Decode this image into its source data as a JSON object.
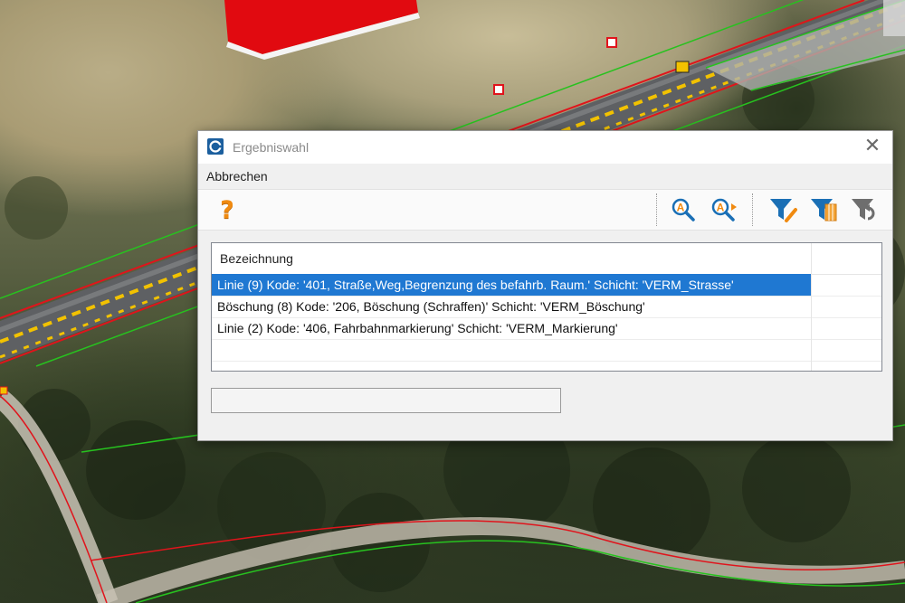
{
  "dialog": {
    "title": "Ergebniswahl",
    "close_glyph": "✕",
    "menu": {
      "cancel_label": "Abbrechen"
    },
    "toolbar": {
      "help_glyph": "?",
      "icons": [
        "help-icon",
        "zoom-to-object-icon",
        "zoom-next-icon",
        "filter-edit-icon",
        "filter-table-icon",
        "filter-reset-icon"
      ]
    },
    "list": {
      "column_header": "Bezeichnung",
      "rows": [
        {
          "label": "Linie (9) Kode: '401, Straße,Weg,Begrenzung des befahrb. Raum.' Schicht: 'VERM_Strasse'",
          "selected": true
        },
        {
          "label": "Böschung (8) Kode: '206, Böschung (Schraffen)' Schicht: 'VERM_Böschung'",
          "selected": false
        },
        {
          "label": "Linie (2) Kode: '406, Fahrbahnmarkierung' Schicht: 'VERM_Markierung'",
          "selected": false
        }
      ]
    },
    "status_text": ""
  },
  "colors": {
    "selection": "#1f78d2",
    "filter_blue": "#1a6fb5",
    "map_red_line": "#e0141c",
    "map_green_line": "#27c21f"
  }
}
